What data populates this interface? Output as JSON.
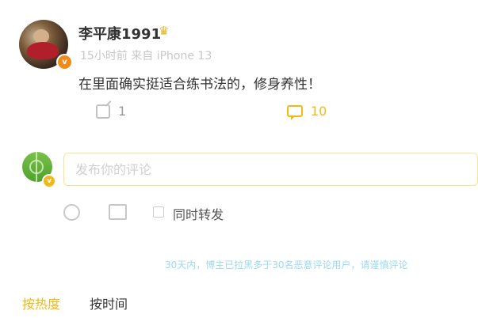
{
  "post": {
    "username": "李平康1991",
    "meta": "15小时前 来自 iPhone 13",
    "content": "在里面确实挺适合练书法的，修身养性！",
    "share_count": "1",
    "comment_count": "10"
  },
  "comment_box": {
    "placeholder": "发布你的评论",
    "repost_label": "同时转发"
  },
  "notice": "30天内，博主已拉黑多于30名恶意评论用户，请谨慎评论",
  "tabs": [
    {
      "label": "按热度",
      "active": true
    },
    {
      "label": "按时间",
      "active": false
    }
  ],
  "icons": {
    "verify": "verified-badge-icon",
    "crown": "member-crown-icon",
    "share": "share-icon",
    "comment": "comment-icon",
    "emoji": "emoji-icon",
    "image": "image-icon"
  },
  "colors": {
    "accent": "#f3b817",
    "notice": "#9cd9f2"
  }
}
